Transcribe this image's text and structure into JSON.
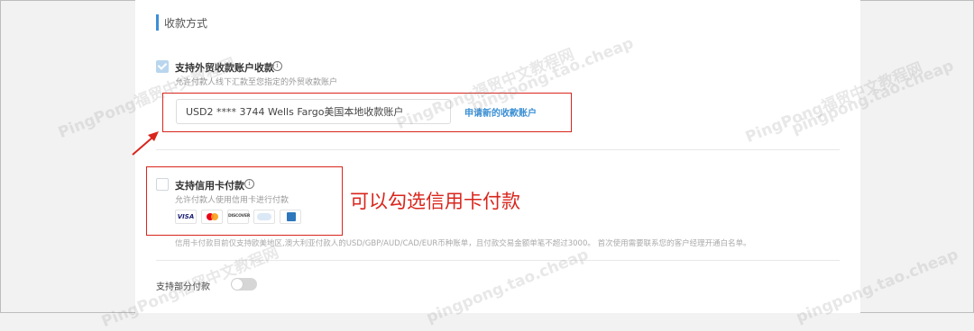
{
  "section": {
    "title": "收款方式"
  },
  "foreign_trade": {
    "checked": true,
    "title": "支持外贸收款账户收款",
    "description": "允许付款人线下汇款至您指定的外贸收款账户",
    "account_value": "USD2  **** 3744  Wells Fargo美国本地收款账户",
    "apply_link": "申请新的收款账户"
  },
  "credit_card": {
    "checked": false,
    "title": "支持信用卡付款",
    "description": "允许付款人使用信用卡进行付款",
    "logos": [
      "VISA",
      "mastercard-icon",
      "DISCOVER",
      "diners-club-icon",
      "amex-icon"
    ],
    "discover_label": "DISCOVER",
    "visa_label": "VISA",
    "note": "信用卡付款目前仅支持欧美地区,澳大利亚付款人的USD/GBP/AUD/CAD/EUR币种账单，且付款交易金额单笔不超过3000。 首次使用需要联系您的客户经理开通白名单。"
  },
  "annotation": {
    "text": "可以勾选信用卡付款",
    "color": "#d9251c"
  },
  "partial_payment": {
    "label": "支持部分付款",
    "enabled": false
  },
  "watermarks": {
    "w1": "PingPong福贸中文教程网",
    "w2": "PingRong福贸中文教程网",
    "w3": "pingpong.tao.cheap",
    "w4": "PingPong福贸中文教程网",
    "w5": "pingpong.tao.cheap",
    "w6": "pingpong.tao.cheap",
    "w7": "PingPong福贸中文教程网",
    "w8": "pingpong.tao.cheap"
  },
  "colors": {
    "accent": "#3d8fd6",
    "link": "#3a8fd4",
    "highlight": "#d9251c"
  }
}
